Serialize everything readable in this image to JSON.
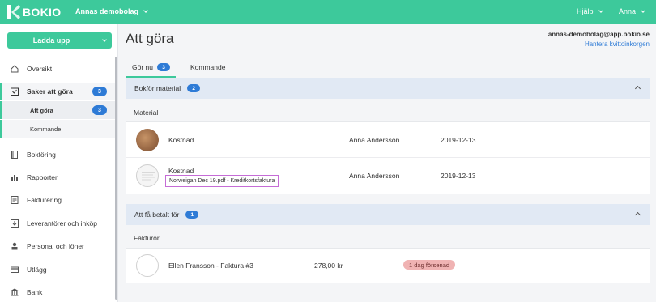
{
  "topbar": {
    "logo_text": "BOKIO",
    "company": "Annas demobolag",
    "help": "Hjälp",
    "user": "Anna"
  },
  "sidebar": {
    "upload_label": "Ladda upp",
    "items": [
      {
        "label": "Översikt",
        "icon": "home-icon"
      },
      {
        "label": "Saker att göra",
        "icon": "checklist-icon",
        "badge": "3"
      },
      {
        "label": "Bokföring",
        "icon": "book-icon"
      },
      {
        "label": "Rapporter",
        "icon": "bar-chart-icon"
      },
      {
        "label": "Fakturering",
        "icon": "invoice-icon"
      },
      {
        "label": "Leverantörer och inköp",
        "icon": "download-box-icon"
      },
      {
        "label": "Personal och löner",
        "icon": "person-icon"
      },
      {
        "label": "Utlägg",
        "icon": "card-icon"
      },
      {
        "label": "Bank",
        "icon": "bank-icon"
      }
    ],
    "sub_items": [
      {
        "label": "Att göra",
        "badge": "3"
      },
      {
        "label": "Kommande"
      }
    ]
  },
  "main": {
    "title": "Att göra",
    "email": "annas-demobolag@app.bokio.se",
    "inbox_link": "Hantera kvittoinkorgen",
    "tabs": [
      {
        "label": "Gör nu",
        "badge": "3"
      },
      {
        "label": "Kommande"
      }
    ],
    "sections": [
      {
        "title": "Bokför material",
        "badge": "2",
        "group_label": "Material",
        "rows": [
          {
            "name": "Kostnad",
            "person": "Anna Andersson",
            "date": "2019-12-13"
          },
          {
            "name": "Kostnad",
            "file": "Norweigan Dec 19.pdf - Kreditkortsfaktura",
            "person": "Anna Andersson",
            "date": "2019-12-13"
          }
        ]
      },
      {
        "title": "Att få betalt för",
        "badge": "1",
        "group_label": "Fakturor",
        "rows": [
          {
            "name": "Ellen Fransson - Faktura #3",
            "amount": "278,00 kr",
            "status": "1 dag försenad"
          }
        ]
      }
    ]
  },
  "colors": {
    "brand": "#3dc99b",
    "badge": "#2e7bd6",
    "late": "#f0b3b3"
  }
}
